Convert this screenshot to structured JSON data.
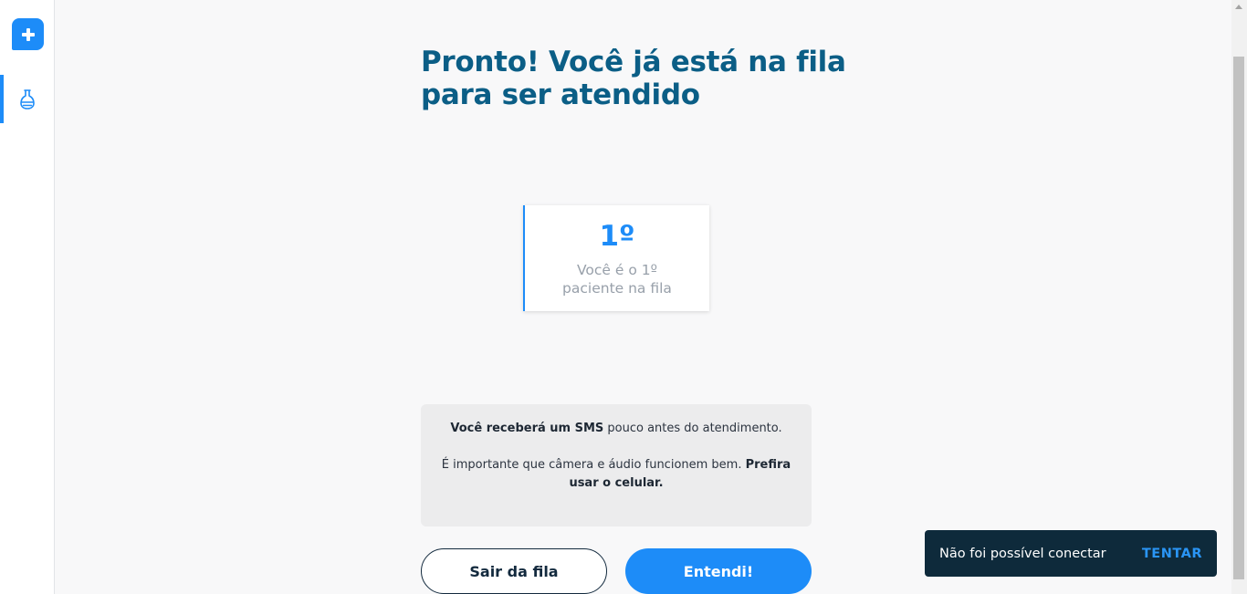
{
  "sidebar": {
    "logo_icon": "plus-icon",
    "nav_items": [
      {
        "icon": "flask-icon",
        "active": true
      }
    ],
    "accent_color": "#1d8cf8"
  },
  "main": {
    "title": "Pronto! Você já está na fila para ser atendido",
    "queue": {
      "position": "1º",
      "caption": "Você é o 1º paciente na fila"
    },
    "info": {
      "sms_bold": "Você receberá um SMS",
      "sms_rest": " pouco antes do atendimento.",
      "tip_text": "É importante que câmera e áudio funcionem bem. ",
      "tip_bold": "Prefira usar o celular."
    },
    "buttons": {
      "leave_queue": "Sair da fila",
      "understood": "Entendi!"
    }
  },
  "snackbar": {
    "message": "Não foi possível conectar",
    "action": "TENTAR"
  },
  "colors": {
    "title": "#0b5e86",
    "primary": "#1d8cf8",
    "snackbar_bg": "#0e2a3b"
  }
}
